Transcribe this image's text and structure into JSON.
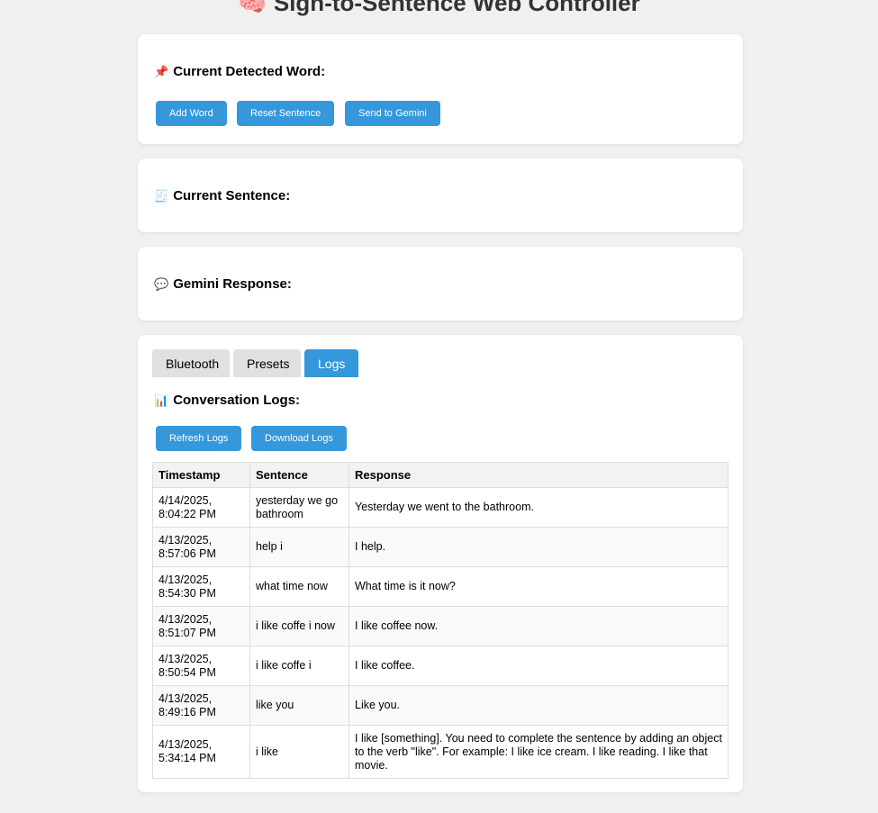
{
  "page": {
    "title_emoji": "🧠",
    "title": "Sign-to-Sentence Web Controller"
  },
  "detected": {
    "icon": "📌",
    "label": "Current Detected Word:",
    "buttons": {
      "add": "Add Word",
      "reset": "Reset Sentence",
      "send": "Send to Gemini"
    }
  },
  "sentence": {
    "icon": "🧾",
    "label": "Current Sentence:"
  },
  "response": {
    "icon": "💬",
    "label": "Gemini Response:"
  },
  "tabs": [
    {
      "label": "Bluetooth"
    },
    {
      "label": "Presets"
    },
    {
      "label": "Logs"
    }
  ],
  "logs": {
    "icon": "📊",
    "label": "Conversation Logs:",
    "refresh": "Refresh Logs",
    "download": "Download Logs",
    "columns": [
      "Timestamp",
      "Sentence",
      "Response"
    ],
    "rows": [
      {
        "timestamp": "4/14/2025, 8:04:22 PM",
        "sentence": "yesterday we go bathroom",
        "response": "Yesterday we went to the bathroom."
      },
      {
        "timestamp": "4/13/2025, 8:57:06 PM",
        "sentence": "help i",
        "response": "I help."
      },
      {
        "timestamp": "4/13/2025, 8:54:30 PM",
        "sentence": "what time now",
        "response": "What time is it now?"
      },
      {
        "timestamp": "4/13/2025, 8:51:07 PM",
        "sentence": "i like coffe i now",
        "response": "I like coffee now."
      },
      {
        "timestamp": "4/13/2025, 8:50:54 PM",
        "sentence": "i like coffe i",
        "response": "I like coffee."
      },
      {
        "timestamp": "4/13/2025, 8:49:16 PM",
        "sentence": "like you",
        "response": "Like you."
      },
      {
        "timestamp": "4/13/2025, 5:34:14 PM",
        "sentence": "i like",
        "response": "I like [something]. You need to complete the sentence by adding an object to the verb \"like\". For example: I like ice cream. I like reading. I like that movie."
      }
    ]
  }
}
